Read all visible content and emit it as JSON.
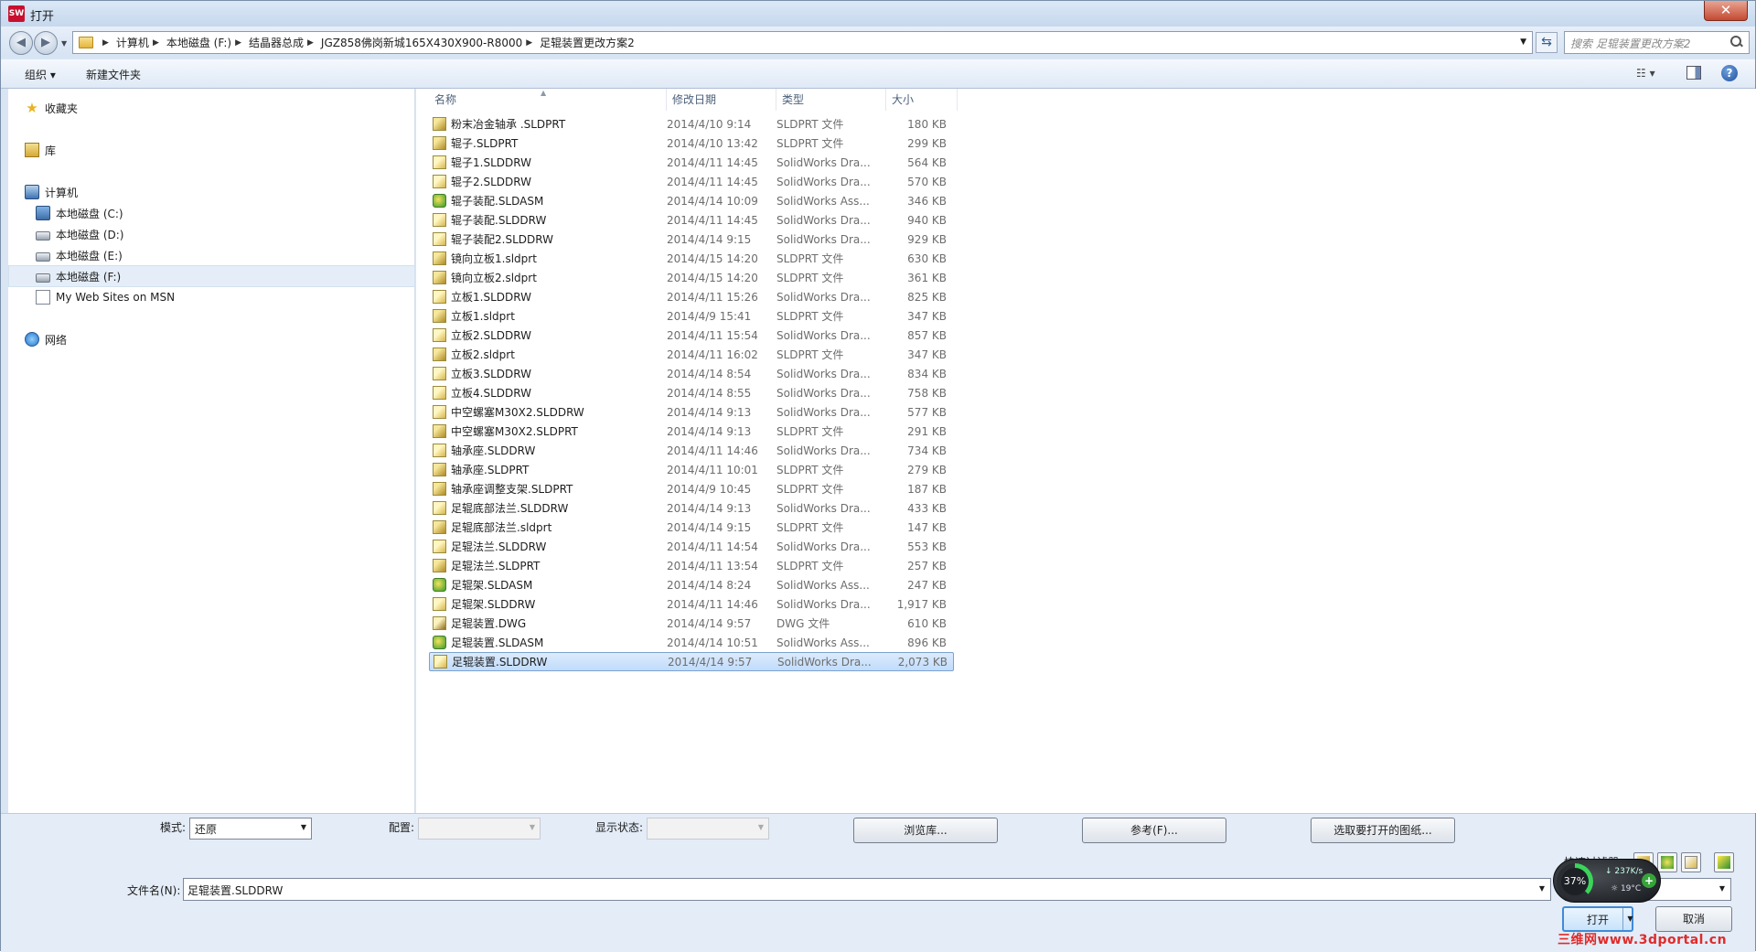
{
  "title": "打开",
  "app_icon_text": "SW",
  "address": {
    "crumbs": [
      "计算机",
      "本地磁盘 (F:)",
      "结晶器总成",
      "JGZ858佛岗新城165X430X900-R8000",
      "足辊装置更改方案2"
    ],
    "search_placeholder": "搜索 足辊装置更改方案2"
  },
  "toolbar": {
    "organize": "组织 ▾",
    "new_folder": "新建文件夹"
  },
  "nav": {
    "favorites": "收藏夹",
    "libraries": "库",
    "computer": "计算机",
    "drives": [
      "本地磁盘 (C:)",
      "本地磁盘 (D:)",
      "本地磁盘 (E:)",
      "本地磁盘 (F:)"
    ],
    "web_sites": "My Web Sites on MSN",
    "network": "网络"
  },
  "columns": {
    "name": "名称",
    "date": "修改日期",
    "type": "类型",
    "size": "大小"
  },
  "files": [
    {
      "name": "粉末冶金轴承 .SLDPRT",
      "date": "2014/4/10 9:14",
      "type": "SLDPRT 文件",
      "size": "180 KB",
      "kind": "prt"
    },
    {
      "name": "辊子.SLDPRT",
      "date": "2014/4/10 13:42",
      "type": "SLDPRT 文件",
      "size": "299 KB",
      "kind": "prt"
    },
    {
      "name": "辊子1.SLDDRW",
      "date": "2014/4/11 14:45",
      "type": "SolidWorks Dra...",
      "size": "564 KB",
      "kind": "drw"
    },
    {
      "name": "辊子2.SLDDRW",
      "date": "2014/4/11 14:45",
      "type": "SolidWorks Dra...",
      "size": "570 KB",
      "kind": "drw"
    },
    {
      "name": "辊子装配.SLDASM",
      "date": "2014/4/14 10:09",
      "type": "SolidWorks Ass...",
      "size": "346 KB",
      "kind": "asm"
    },
    {
      "name": "辊子装配.SLDDRW",
      "date": "2014/4/11 14:45",
      "type": "SolidWorks Dra...",
      "size": "940 KB",
      "kind": "drw"
    },
    {
      "name": "辊子装配2.SLDDRW",
      "date": "2014/4/14 9:15",
      "type": "SolidWorks Dra...",
      "size": "929 KB",
      "kind": "drw"
    },
    {
      "name": "镜向立板1.sldprt",
      "date": "2014/4/15 14:20",
      "type": "SLDPRT 文件",
      "size": "630 KB",
      "kind": "prt"
    },
    {
      "name": "镜向立板2.sldprt",
      "date": "2014/4/15 14:20",
      "type": "SLDPRT 文件",
      "size": "361 KB",
      "kind": "prt"
    },
    {
      "name": "立板1.SLDDRW",
      "date": "2014/4/11 15:26",
      "type": "SolidWorks Dra...",
      "size": "825 KB",
      "kind": "drw"
    },
    {
      "name": "立板1.sldprt",
      "date": "2014/4/9 15:41",
      "type": "SLDPRT 文件",
      "size": "347 KB",
      "kind": "prt"
    },
    {
      "name": "立板2.SLDDRW",
      "date": "2014/4/11 15:54",
      "type": "SolidWorks Dra...",
      "size": "857 KB",
      "kind": "drw"
    },
    {
      "name": "立板2.sldprt",
      "date": "2014/4/11 16:02",
      "type": "SLDPRT 文件",
      "size": "347 KB",
      "kind": "prt"
    },
    {
      "name": "立板3.SLDDRW",
      "date": "2014/4/14 8:54",
      "type": "SolidWorks Dra...",
      "size": "834 KB",
      "kind": "drw"
    },
    {
      "name": "立板4.SLDDRW",
      "date": "2014/4/14 8:55",
      "type": "SolidWorks Dra...",
      "size": "758 KB",
      "kind": "drw"
    },
    {
      "name": "中空螺塞M30X2.SLDDRW",
      "date": "2014/4/14 9:13",
      "type": "SolidWorks Dra...",
      "size": "577 KB",
      "kind": "drw"
    },
    {
      "name": "中空螺塞M30X2.SLDPRT",
      "date": "2014/4/14 9:13",
      "type": "SLDPRT 文件",
      "size": "291 KB",
      "kind": "prt"
    },
    {
      "name": "轴承座.SLDDRW",
      "date": "2014/4/11 14:46",
      "type": "SolidWorks Dra...",
      "size": "734 KB",
      "kind": "drw"
    },
    {
      "name": "轴承座.SLDPRT",
      "date": "2014/4/11 10:01",
      "type": "SLDPRT 文件",
      "size": "279 KB",
      "kind": "prt"
    },
    {
      "name": "轴承座调整支架.SLDPRT",
      "date": "2014/4/9 10:45",
      "type": "SLDPRT 文件",
      "size": "187 KB",
      "kind": "prt"
    },
    {
      "name": "足辊底部法兰.SLDDRW",
      "date": "2014/4/14 9:13",
      "type": "SolidWorks Dra...",
      "size": "433 KB",
      "kind": "drw"
    },
    {
      "name": "足辊底部法兰.sldprt",
      "date": "2014/4/14 9:15",
      "type": "SLDPRT 文件",
      "size": "147 KB",
      "kind": "prt"
    },
    {
      "name": "足辊法兰.SLDDRW",
      "date": "2014/4/11 14:54",
      "type": "SolidWorks Dra...",
      "size": "553 KB",
      "kind": "drw"
    },
    {
      "name": "足辊法兰.SLDPRT",
      "date": "2014/4/11 13:54",
      "type": "SLDPRT 文件",
      "size": "257 KB",
      "kind": "prt"
    },
    {
      "name": "足辊架.SLDASM",
      "date": "2014/4/14 8:24",
      "type": "SolidWorks Ass...",
      "size": "247 KB",
      "kind": "asm"
    },
    {
      "name": "足辊架.SLDDRW",
      "date": "2014/4/11 14:46",
      "type": "SolidWorks Dra...",
      "size": "1,917 KB",
      "kind": "drw"
    },
    {
      "name": "足辊装置.DWG",
      "date": "2014/4/14 9:57",
      "type": "DWG 文件",
      "size": "610 KB",
      "kind": "dwg"
    },
    {
      "name": "足辊装置.SLDASM",
      "date": "2014/4/14 10:51",
      "type": "SolidWorks Ass...",
      "size": "896 KB",
      "kind": "asm"
    },
    {
      "name": "足辊装置.SLDDRW",
      "date": "2014/4/14 9:57",
      "type": "SolidWorks Dra...",
      "size": "2,073 KB",
      "kind": "drw",
      "selected": true
    }
  ],
  "bottom": {
    "mode_label": "模式:",
    "mode_value": "还原",
    "config_label": "配置:",
    "display_label": "显示状态:",
    "browse_lib": "浏览库...",
    "reference": "参考(F)...",
    "select_sheets": "选取要打开的图纸...",
    "filename_label": "文件名(N):",
    "filename_value": "足辊装置.SLDDRW",
    "quick_filter": "快速过滤器：",
    "open": "打开",
    "cancel": "取消"
  },
  "widget": {
    "cpu": "37%",
    "net": "237K/s",
    "temp": "19°C",
    "plus": "+"
  },
  "watermark": "三维网www.3dportal.cn",
  "colors": {
    "selection": "#cce4fc",
    "accent": "#3f8ad8",
    "chrome": "#d9e5f3"
  }
}
